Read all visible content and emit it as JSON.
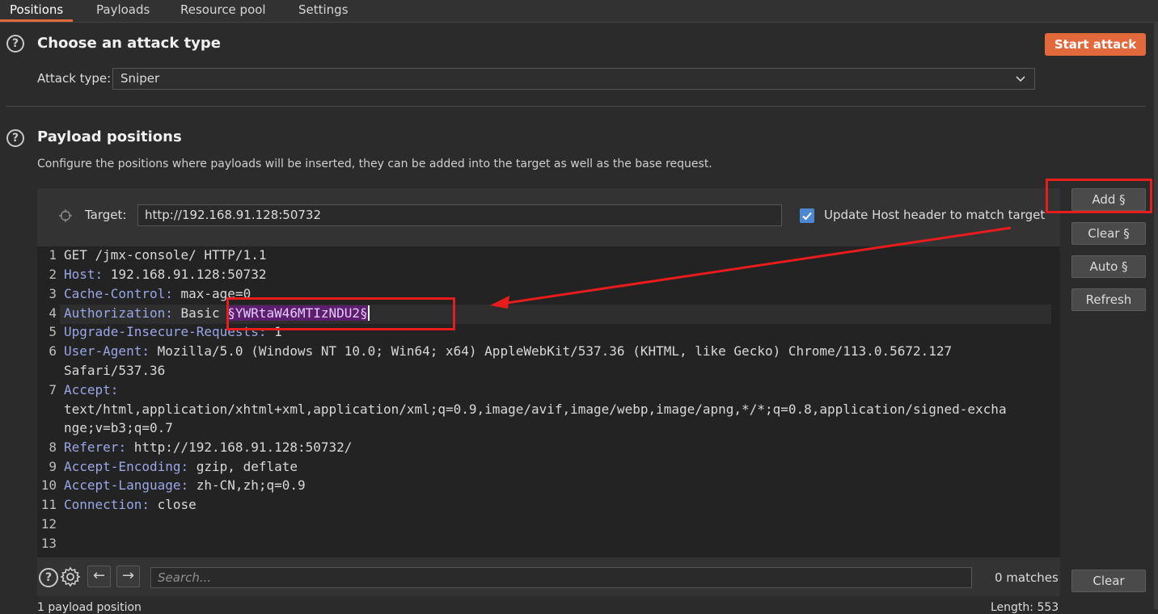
{
  "tabs": [
    "Positions",
    "Payloads",
    "Resource pool",
    "Settings"
  ],
  "attack": {
    "heading": "Choose an attack type",
    "start_label": "Start attack",
    "type_label": "Attack type:",
    "type_value": "Sniper"
  },
  "positions": {
    "heading": "Payload positions",
    "description": "Configure the positions where payloads will be inserted, they can be added into the target as well as the base request.",
    "target_label": "Target:",
    "target_value": "http://192.168.91.128:50732",
    "update_host_label": "Update Host header to match target",
    "update_host_checked": true
  },
  "side_buttons": {
    "add": "Add §",
    "clear": "Clear §",
    "auto": "Auto §",
    "refresh": "Refresh",
    "clear_bottom": "Clear"
  },
  "request_lines": [
    {
      "n": "1",
      "key": "",
      "val": "GET /jmx-console/ HTTP/1.1"
    },
    {
      "n": "2",
      "key": "Host",
      "val": "192.168.91.128:50732"
    },
    {
      "n": "3",
      "key": "Cache-Control",
      "val": "max-age=0"
    },
    {
      "n": "4",
      "key": "Authorization",
      "val": "Basic ",
      "payload": "§YWRtaW46MTIzNDU2§"
    },
    {
      "n": "5",
      "key": "Upgrade-Insecure-Requests",
      "val": "1"
    },
    {
      "n": "6",
      "key": "User-Agent",
      "val": "Mozilla/5.0 (Windows NT 10.0; Win64; x64) AppleWebKit/537.36 (KHTML, like Gecko) Chrome/113.0.5672.127",
      "cont": [
        "Safari/537.36"
      ]
    },
    {
      "n": "7",
      "key": "Accept",
      "val": "",
      "cont": [
        "text/html,application/xhtml+xml,application/xml;q=0.9,image/avif,image/webp,image/apng,*/*;q=0.8,application/signed-excha",
        "nge;v=b3;q=0.7"
      ]
    },
    {
      "n": "8",
      "key": "Referer",
      "val": "http://192.168.91.128:50732/"
    },
    {
      "n": "9",
      "key": "Accept-Encoding",
      "val": "gzip, deflate"
    },
    {
      "n": "10",
      "key": "Accept-Language",
      "val": "zh-CN,zh;q=0.9"
    },
    {
      "n": "11",
      "key": "Connection",
      "val": "close"
    },
    {
      "n": "12",
      "key": "",
      "val": ""
    },
    {
      "n": "13",
      "key": "",
      "val": ""
    }
  ],
  "search": {
    "placeholder": "Search...",
    "matches": "0 matches"
  },
  "footer": {
    "left": "1 payload position",
    "right": "Length: 553"
  },
  "colors": {
    "accent": "#e2693b",
    "annotation": "#e81c1c",
    "payload_highlight": "#5c1f6e"
  }
}
